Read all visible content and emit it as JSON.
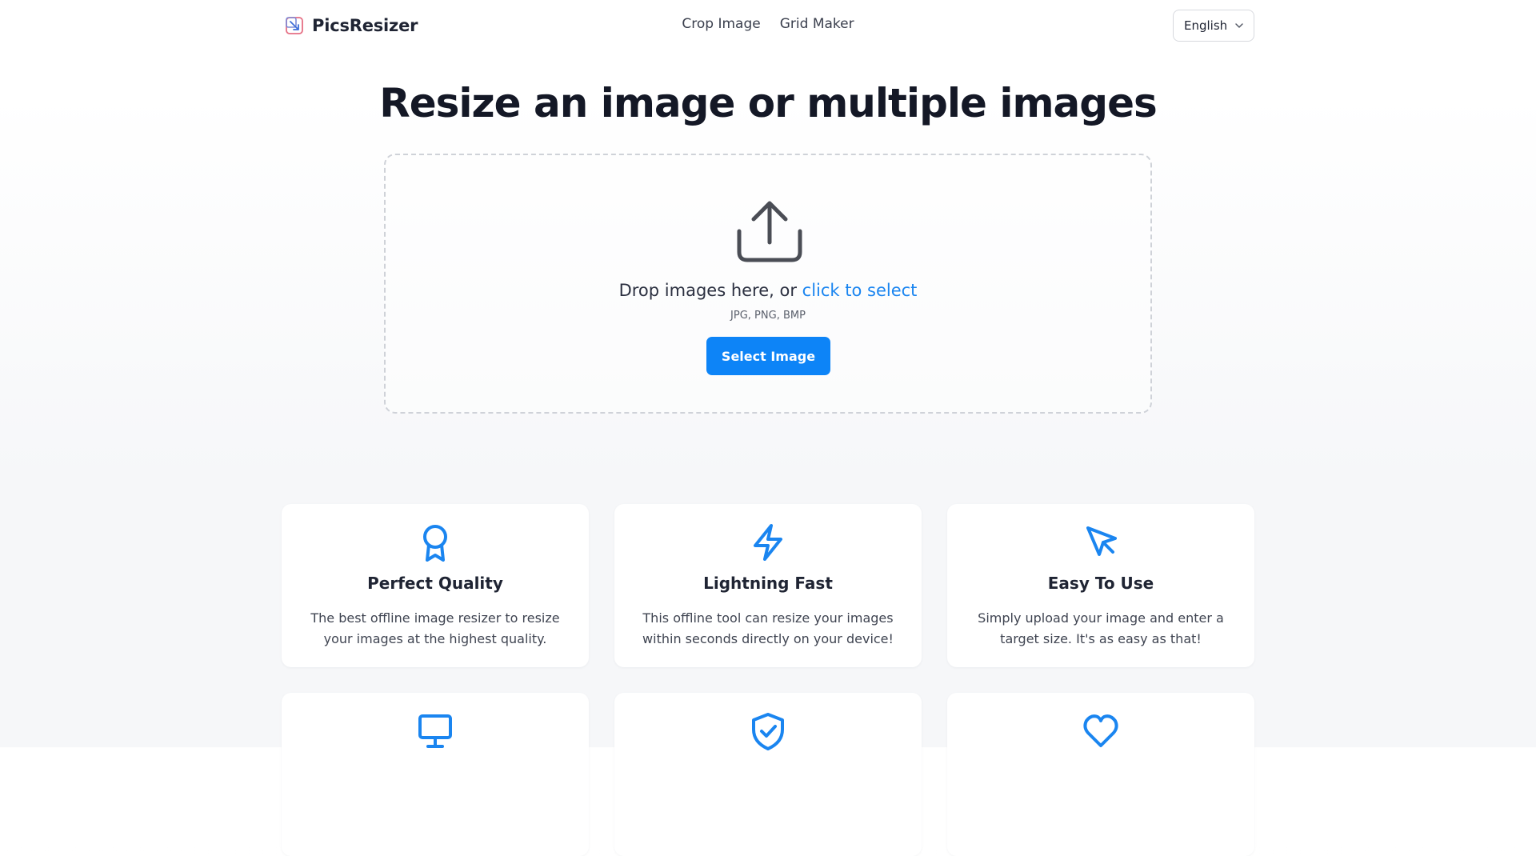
{
  "header": {
    "brand": "PicsResizer",
    "nav": [
      {
        "label": "Crop Image"
      },
      {
        "label": "Grid Maker"
      }
    ],
    "language": "English"
  },
  "main": {
    "title": "Resize an image or multiple images",
    "dropzone": {
      "text": "Drop images here, or ",
      "link": "click to select",
      "formats": "JPG, PNG, BMP",
      "button": "Select Image"
    }
  },
  "features": [
    {
      "icon": "award-icon",
      "title": "Perfect Quality",
      "desc": "The best offline image resizer to resize your images at the highest quality."
    },
    {
      "icon": "lightning-icon",
      "title": "Lightning Fast",
      "desc": "This offline tool can resize your images within seconds directly on your device!"
    },
    {
      "icon": "cursor-icon",
      "title": "Easy To Use",
      "desc": "Simply upload your image and enter a target size. It's as easy as that!"
    },
    {
      "icon": "monitor-icon"
    },
    {
      "icon": "shield-check-icon"
    },
    {
      "icon": "heart-icon"
    }
  ],
  "colors": {
    "accent": "#0d84f7",
    "link": "#1a85f0",
    "text": "#1f2433"
  }
}
